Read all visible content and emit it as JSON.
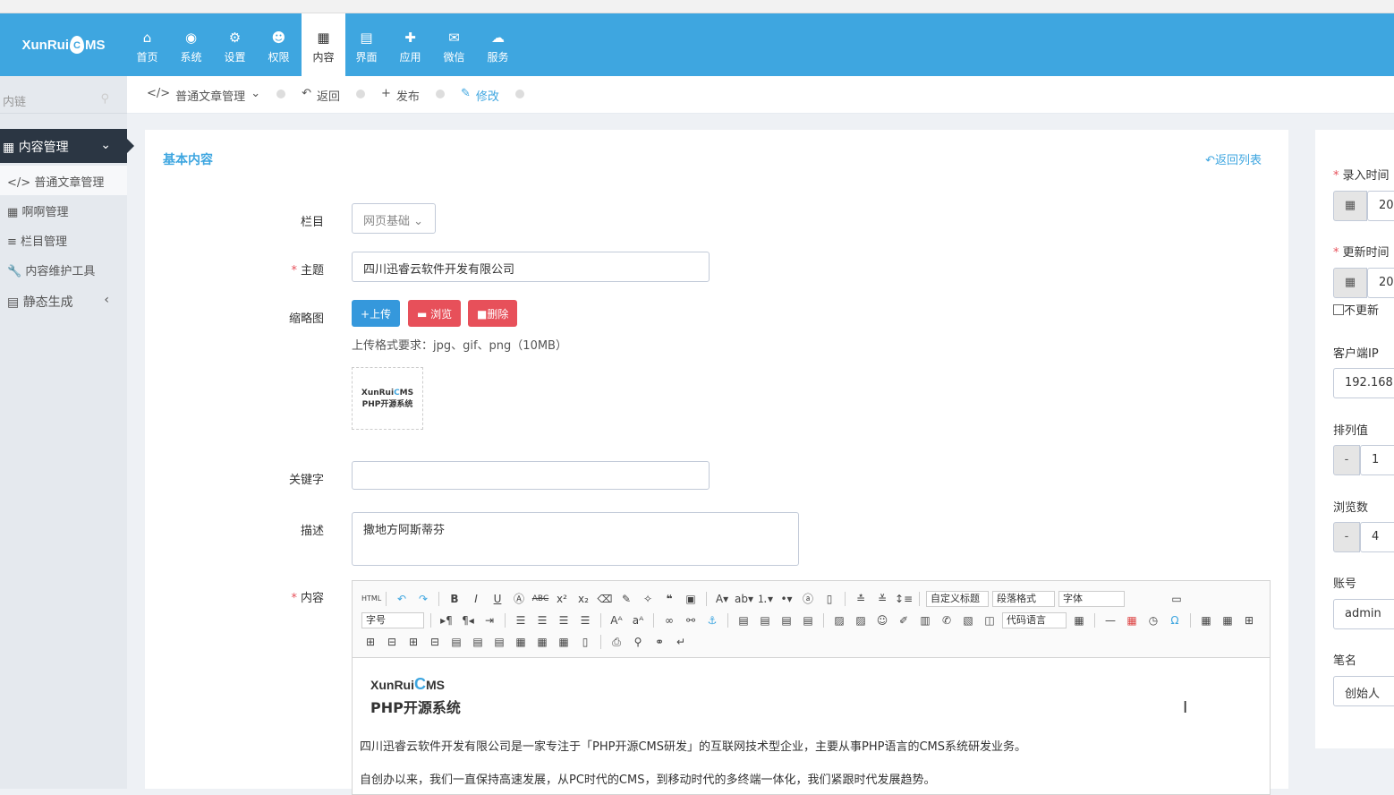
{
  "colors": {
    "topnav": "#3ea6e0",
    "sidebar_active": "#2b3643",
    "upload": "#3598dc",
    "browse": "#e7505a",
    "delete": "#e7505a"
  },
  "brand": {
    "logo_text_left": "XunRui",
    "logo_drop": "C",
    "logo_text_right": "MS"
  },
  "topnav": {
    "items": [
      {
        "icon": "home-icon",
        "glyph": "⌂",
        "label": "首页"
      },
      {
        "icon": "globe-icon",
        "glyph": "◉",
        "label": "系统"
      },
      {
        "icon": "gears-icon",
        "glyph": "⚙",
        "label": "设置"
      },
      {
        "icon": "user-icon",
        "glyph": "☻",
        "label": "权限"
      },
      {
        "icon": "grid-icon",
        "glyph": "▦",
        "label": "内容"
      },
      {
        "icon": "html5-icon",
        "glyph": "▤",
        "label": "界面"
      },
      {
        "icon": "puzzle-icon",
        "glyph": "✚",
        "label": "应用"
      },
      {
        "icon": "wechat-icon",
        "glyph": "✉",
        "label": "微信"
      },
      {
        "icon": "cloud-icon",
        "glyph": "☁",
        "label": "服务"
      }
    ]
  },
  "sidebar": {
    "search_placeholder": "内链",
    "head": "内容管理",
    "items": [
      {
        "icon": "code-icon",
        "glyph": "</>",
        "label": "普通文章管理"
      },
      {
        "icon": "table-icon",
        "glyph": "▦",
        "label": "啊啊管理"
      },
      {
        "icon": "list-icon",
        "glyph": "≡",
        "label": "栏目管理"
      },
      {
        "icon": "wrench-icon",
        "glyph": "🔧",
        "label": "内容维护工具"
      },
      {
        "icon": "file-icon",
        "glyph": "▤",
        "label": "静态生成"
      }
    ]
  },
  "breadcrumb": {
    "module": "普通文章管理",
    "back": "返回",
    "publish": "发布",
    "edit": "修改"
  },
  "form": {
    "section_title": "基本内容",
    "back_list": "返回列表",
    "category_label": "栏目",
    "category_value": "网页基础",
    "title_label": "主题",
    "title_value": "四川迅睿云软件开发有限公司",
    "thumb_label": "缩略图",
    "upload_btn": "上传",
    "browse_btn": "浏览",
    "delete_btn": "删除",
    "upload_hint": "上传格式要求：jpg、gif、png（10MB）",
    "thumb_caption": "PHP开源系统",
    "keywords_label": "关键字",
    "keywords_value": "",
    "desc_label": "描述",
    "desc_value": "撒地方阿斯蒂芬",
    "content_label": "内容"
  },
  "editor": {
    "sel_custom_title": "自定义标题",
    "sel_paragraph": "段落格式",
    "sel_font": "字体",
    "sel_size": "字号",
    "sel_code": "代码语言",
    "logo_caption": "PHP开源系统",
    "para1": "四川迅睿云软件开发有限公司是一家专注于「PHP开源CMS研发」的互联网技术型企业，主要从事PHP语言的CMS系统研发业务。",
    "para2": "自创办以来，我们一直保持高速发展，从PC时代的CMS，到移动时代的多终端一体化，我们紧跟时代发展趋势。"
  },
  "side": {
    "entry_time_label": "录入时间",
    "entry_time_value": "20",
    "update_time_label": "更新时间",
    "update_time_value": "20",
    "no_update_label": "不更新",
    "ip_label": "客户端IP",
    "ip_value": "192.168.",
    "order_label": "排列值",
    "order_value": "1",
    "views_label": "浏览数",
    "views_value": "4",
    "account_label": "账号",
    "account_value": "admin",
    "author_label": "笔名",
    "author_value": "创始人",
    "minus": "-"
  }
}
